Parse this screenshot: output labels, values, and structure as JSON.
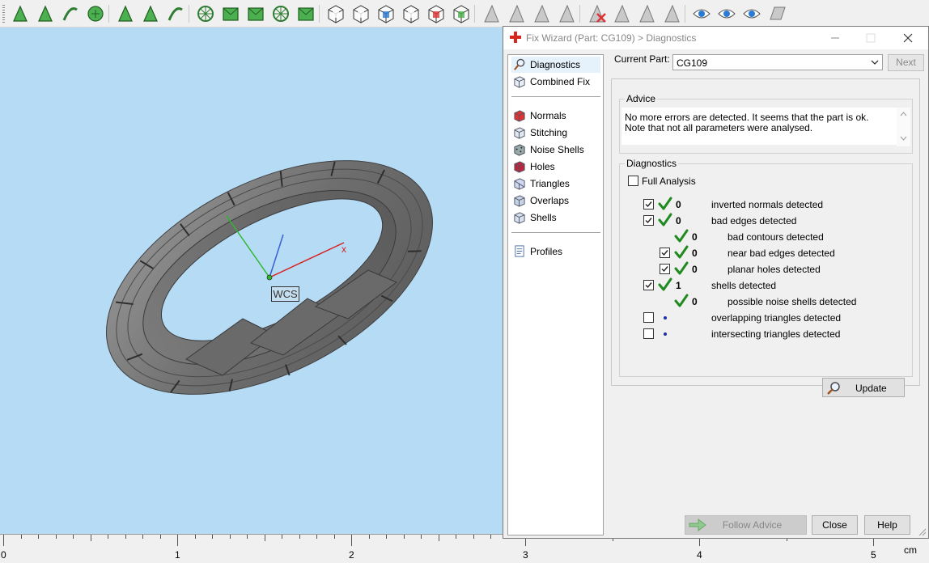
{
  "toolbar": {
    "icons": [
      "select-arrow-icon",
      "mark-triangle-icon",
      "mark-surface-icon",
      "mark-shell-icon",
      "rectangle-select-icon",
      "lasso-select-icon",
      "brush-select-icon",
      "triangle-mode-icon",
      "surface-mode-icon",
      "shell-mode-icon",
      "wave-mode-icon",
      "ring-mode-icon",
      "cube-front-icon",
      "cube-top-icon",
      "cube-color-icon",
      "cube-wire-icon",
      "cube-red-icon",
      "cube-green-icon",
      "plane-cut-icon",
      "plane-mark-icon",
      "plane-expand-icon",
      "plane-link-icon",
      "delete-marked-icon",
      "invert-marked-icon",
      "copy-marked-icon",
      "shell-marked-icon",
      "view-eye-icon",
      "view-shells-icon",
      "view-eye-blue-icon",
      "view-plane-icon"
    ]
  },
  "viewport": {
    "background": "#b6dbf5",
    "wcs_label": "WCS",
    "axis_x_label": "x"
  },
  "ruler": {
    "labels": [
      "0",
      "1",
      "2",
      "3",
      "4",
      "5"
    ],
    "unit": "cm"
  },
  "dialog": {
    "title": "Fix Wizard (Part: CG109) > Diagnostics",
    "nav_top": [
      {
        "label": "Diagnostics",
        "icon": "magnifier-icon",
        "selected": true
      },
      {
        "label": "Combined Fix",
        "icon": "combined-fix-icon",
        "selected": false
      }
    ],
    "nav_fixes": [
      {
        "label": "Normals",
        "icon": "normals-icon"
      },
      {
        "label": "Stitching",
        "icon": "stitching-icon"
      },
      {
        "label": "Noise Shells",
        "icon": "noise-shells-icon"
      },
      {
        "label": "Holes",
        "icon": "holes-icon"
      },
      {
        "label": "Triangles",
        "icon": "triangles-icon"
      },
      {
        "label": "Overlaps",
        "icon": "overlaps-icon"
      },
      {
        "label": "Shells",
        "icon": "shells-icon"
      }
    ],
    "nav_bottom": [
      {
        "label": "Profiles",
        "icon": "profiles-icon"
      }
    ],
    "current_part_label": "Current Part:",
    "current_part_value": "CG109",
    "next_label": "Next",
    "advice": {
      "title": "Advice",
      "text": "No more errors are detected. It seems that the part is ok. Note that not all parameters were analysed."
    },
    "diagnostics": {
      "title": "Diagnostics",
      "full_analysis_label": "Full Analysis",
      "full_analysis_checked": false,
      "rows": [
        {
          "checked": true,
          "status": "ok",
          "count": "0",
          "label": "inverted normals detected",
          "indent": 0,
          "has_checkbox": true
        },
        {
          "checked": true,
          "status": "ok",
          "count": "0",
          "label": "bad edges detected",
          "indent": 0,
          "has_checkbox": true
        },
        {
          "checked": false,
          "status": "ok",
          "count": "0",
          "label": "bad contours detected",
          "indent": 1,
          "has_checkbox": false
        },
        {
          "checked": true,
          "status": "ok",
          "count": "0",
          "label": "near bad edges detected",
          "indent": 1,
          "has_checkbox": true
        },
        {
          "checked": true,
          "status": "ok",
          "count": "0",
          "label": "planar holes detected",
          "indent": 1,
          "has_checkbox": true
        },
        {
          "checked": true,
          "status": "ok",
          "count": "1",
          "label": "shells detected",
          "indent": 0,
          "has_checkbox": true
        },
        {
          "checked": false,
          "status": "ok",
          "count": "0",
          "label": "possible noise shells detected",
          "indent": 1,
          "has_checkbox": false
        },
        {
          "checked": false,
          "status": "none",
          "count": "",
          "label": "overlapping triangles detected",
          "indent": 0,
          "has_checkbox": true
        },
        {
          "checked": false,
          "status": "none",
          "count": "",
          "label": "intersecting triangles detected",
          "indent": 0,
          "has_checkbox": true
        }
      ],
      "update_label": "Update"
    },
    "buttons": {
      "follow_advice": "Follow Advice",
      "close": "Close",
      "help": "Help"
    },
    "colors": {
      "check_green": "#1f8a1f",
      "dot_blue": "#1e2fa0"
    }
  }
}
